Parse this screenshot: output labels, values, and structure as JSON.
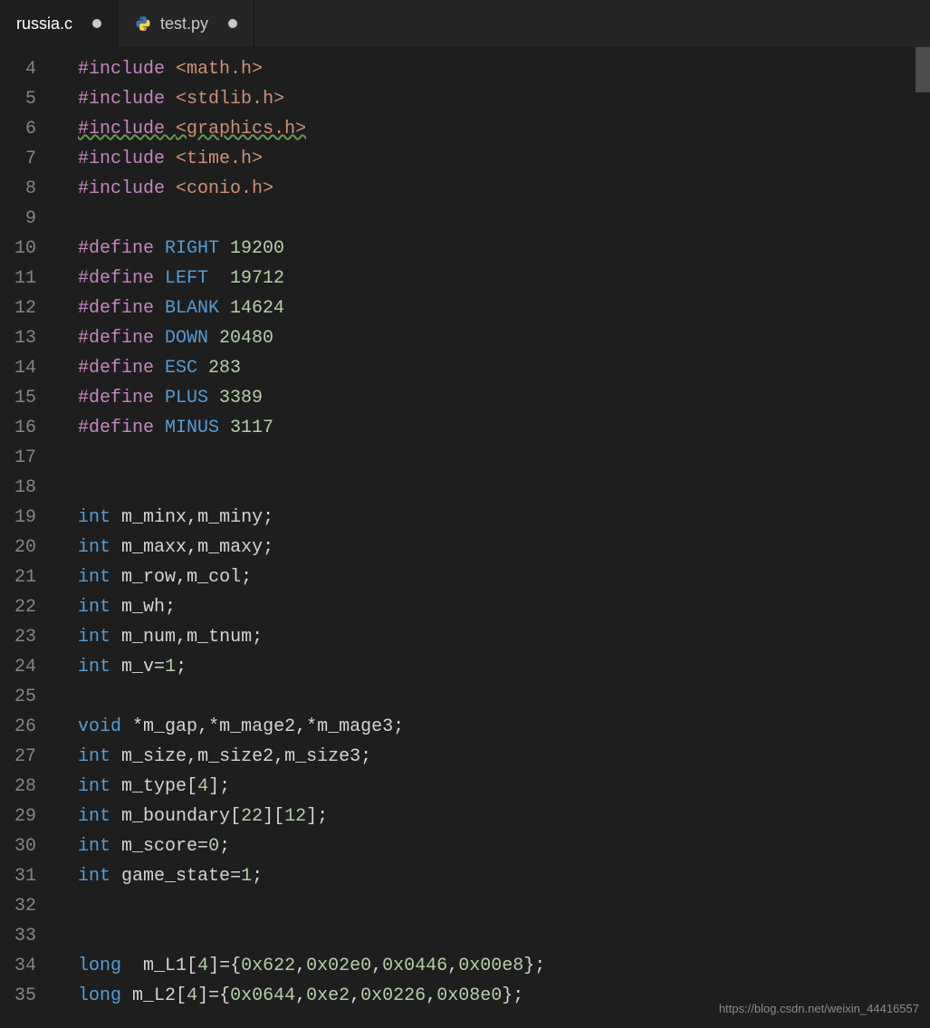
{
  "tabs": [
    {
      "label": "russia.c",
      "icon": null,
      "modified": true,
      "active": true
    },
    {
      "label": "test.py",
      "icon": "python",
      "modified": true,
      "active": false
    }
  ],
  "line_start": 4,
  "code_lines": [
    {
      "n": 4,
      "tokens": [
        [
          "kw",
          "#include "
        ],
        [
          "str",
          "<math.h>"
        ]
      ]
    },
    {
      "n": 5,
      "tokens": [
        [
          "kw",
          "#include "
        ],
        [
          "str",
          "<stdlib.h>"
        ]
      ]
    },
    {
      "n": 6,
      "tokens": [
        [
          "kw-sq",
          "#include "
        ],
        [
          "str-sq",
          "<graphics.h>"
        ]
      ]
    },
    {
      "n": 7,
      "tokens": [
        [
          "kw",
          "#include "
        ],
        [
          "str",
          "<time.h>"
        ]
      ]
    },
    {
      "n": 8,
      "tokens": [
        [
          "kw",
          "#include "
        ],
        [
          "str",
          "<conio.h>"
        ]
      ]
    },
    {
      "n": 9,
      "tokens": []
    },
    {
      "n": 10,
      "tokens": [
        [
          "kw",
          "#define "
        ],
        [
          "macro",
          "RIGHT "
        ],
        [
          "num",
          "19200"
        ]
      ]
    },
    {
      "n": 11,
      "tokens": [
        [
          "kw",
          "#define "
        ],
        [
          "macro",
          "LEFT  "
        ],
        [
          "num",
          "19712"
        ]
      ]
    },
    {
      "n": 12,
      "tokens": [
        [
          "kw",
          "#define "
        ],
        [
          "macro",
          "BLANK "
        ],
        [
          "num",
          "14624"
        ]
      ]
    },
    {
      "n": 13,
      "tokens": [
        [
          "kw",
          "#define "
        ],
        [
          "macro",
          "DOWN "
        ],
        [
          "num",
          "20480"
        ]
      ]
    },
    {
      "n": 14,
      "tokens": [
        [
          "kw",
          "#define "
        ],
        [
          "macro",
          "ESC "
        ],
        [
          "num",
          "283"
        ]
      ]
    },
    {
      "n": 15,
      "tokens": [
        [
          "kw",
          "#define "
        ],
        [
          "macro",
          "PLUS "
        ],
        [
          "num",
          "3389"
        ]
      ]
    },
    {
      "n": 16,
      "tokens": [
        [
          "kw",
          "#define "
        ],
        [
          "macro",
          "MINUS "
        ],
        [
          "num",
          "3117"
        ]
      ]
    },
    {
      "n": 17,
      "tokens": []
    },
    {
      "n": 18,
      "tokens": []
    },
    {
      "n": 19,
      "tokens": [
        [
          "type",
          "int "
        ],
        [
          "ident",
          "m_minx"
        ],
        [
          "op",
          ","
        ],
        [
          "ident",
          "m_miny"
        ],
        [
          "op",
          ";"
        ]
      ]
    },
    {
      "n": 20,
      "tokens": [
        [
          "type",
          "int "
        ],
        [
          "ident",
          "m_maxx"
        ],
        [
          "op",
          ","
        ],
        [
          "ident",
          "m_maxy"
        ],
        [
          "op",
          ";"
        ]
      ]
    },
    {
      "n": 21,
      "tokens": [
        [
          "type",
          "int "
        ],
        [
          "ident",
          "m_row"
        ],
        [
          "op",
          ","
        ],
        [
          "ident",
          "m_col"
        ],
        [
          "op",
          ";"
        ]
      ]
    },
    {
      "n": 22,
      "tokens": [
        [
          "type",
          "int "
        ],
        [
          "ident",
          "m_wh"
        ],
        [
          "op",
          ";"
        ]
      ]
    },
    {
      "n": 23,
      "tokens": [
        [
          "type",
          "int "
        ],
        [
          "ident",
          "m_num"
        ],
        [
          "op",
          ","
        ],
        [
          "ident",
          "m_tnum"
        ],
        [
          "op",
          ";"
        ]
      ]
    },
    {
      "n": 24,
      "tokens": [
        [
          "type",
          "int "
        ],
        [
          "ident",
          "m_v"
        ],
        [
          "op",
          "="
        ],
        [
          "num",
          "1"
        ],
        [
          "op",
          ";"
        ]
      ]
    },
    {
      "n": 25,
      "tokens": []
    },
    {
      "n": 26,
      "tokens": [
        [
          "type",
          "void "
        ],
        [
          "op",
          "*"
        ],
        [
          "ident",
          "m_gap"
        ],
        [
          "op",
          ",*"
        ],
        [
          "ident",
          "m_mage2"
        ],
        [
          "op",
          ",*"
        ],
        [
          "ident",
          "m_mage3"
        ],
        [
          "op",
          ";"
        ]
      ]
    },
    {
      "n": 27,
      "tokens": [
        [
          "type",
          "int "
        ],
        [
          "ident",
          "m_size"
        ],
        [
          "op",
          ","
        ],
        [
          "ident",
          "m_size2"
        ],
        [
          "op",
          ","
        ],
        [
          "ident",
          "m_size3"
        ],
        [
          "op",
          ";"
        ]
      ]
    },
    {
      "n": 28,
      "tokens": [
        [
          "type",
          "int "
        ],
        [
          "ident",
          "m_type"
        ],
        [
          "op",
          "["
        ],
        [
          "num",
          "4"
        ],
        [
          "op",
          "];"
        ]
      ]
    },
    {
      "n": 29,
      "tokens": [
        [
          "type",
          "int "
        ],
        [
          "ident",
          "m_boundary"
        ],
        [
          "op",
          "["
        ],
        [
          "num",
          "22"
        ],
        [
          "op",
          "]["
        ],
        [
          "num",
          "12"
        ],
        [
          "op",
          "];"
        ]
      ]
    },
    {
      "n": 30,
      "tokens": [
        [
          "type",
          "int "
        ],
        [
          "ident",
          "m_score"
        ],
        [
          "op",
          "="
        ],
        [
          "num",
          "0"
        ],
        [
          "op",
          ";"
        ]
      ]
    },
    {
      "n": 31,
      "tokens": [
        [
          "type",
          "int "
        ],
        [
          "ident",
          "game_state"
        ],
        [
          "op",
          "="
        ],
        [
          "num",
          "1"
        ],
        [
          "op",
          ";"
        ]
      ]
    },
    {
      "n": 32,
      "tokens": []
    },
    {
      "n": 33,
      "tokens": []
    },
    {
      "n": 34,
      "tokens": [
        [
          "type",
          "long  "
        ],
        [
          "ident",
          "m_L1"
        ],
        [
          "op",
          "["
        ],
        [
          "num",
          "4"
        ],
        [
          "op",
          "]={"
        ],
        [
          "num",
          "0x622"
        ],
        [
          "op",
          ","
        ],
        [
          "num",
          "0x02e0"
        ],
        [
          "op",
          ","
        ],
        [
          "num",
          "0x0446"
        ],
        [
          "op",
          ","
        ],
        [
          "num",
          "0x00e8"
        ],
        [
          "op",
          "};"
        ]
      ]
    },
    {
      "n": 35,
      "tokens": [
        [
          "type",
          "long "
        ],
        [
          "ident",
          "m_L2"
        ],
        [
          "op",
          "["
        ],
        [
          "num",
          "4"
        ],
        [
          "op",
          "]={"
        ],
        [
          "num",
          "0x0644"
        ],
        [
          "op",
          ","
        ],
        [
          "num",
          "0xe2"
        ],
        [
          "op",
          ","
        ],
        [
          "num",
          "0x0226"
        ],
        [
          "op",
          ","
        ],
        [
          "num",
          "0x08e0"
        ],
        [
          "op",
          "};"
        ]
      ]
    }
  ],
  "watermark": "https://blog.csdn.net/weixin_44416557"
}
